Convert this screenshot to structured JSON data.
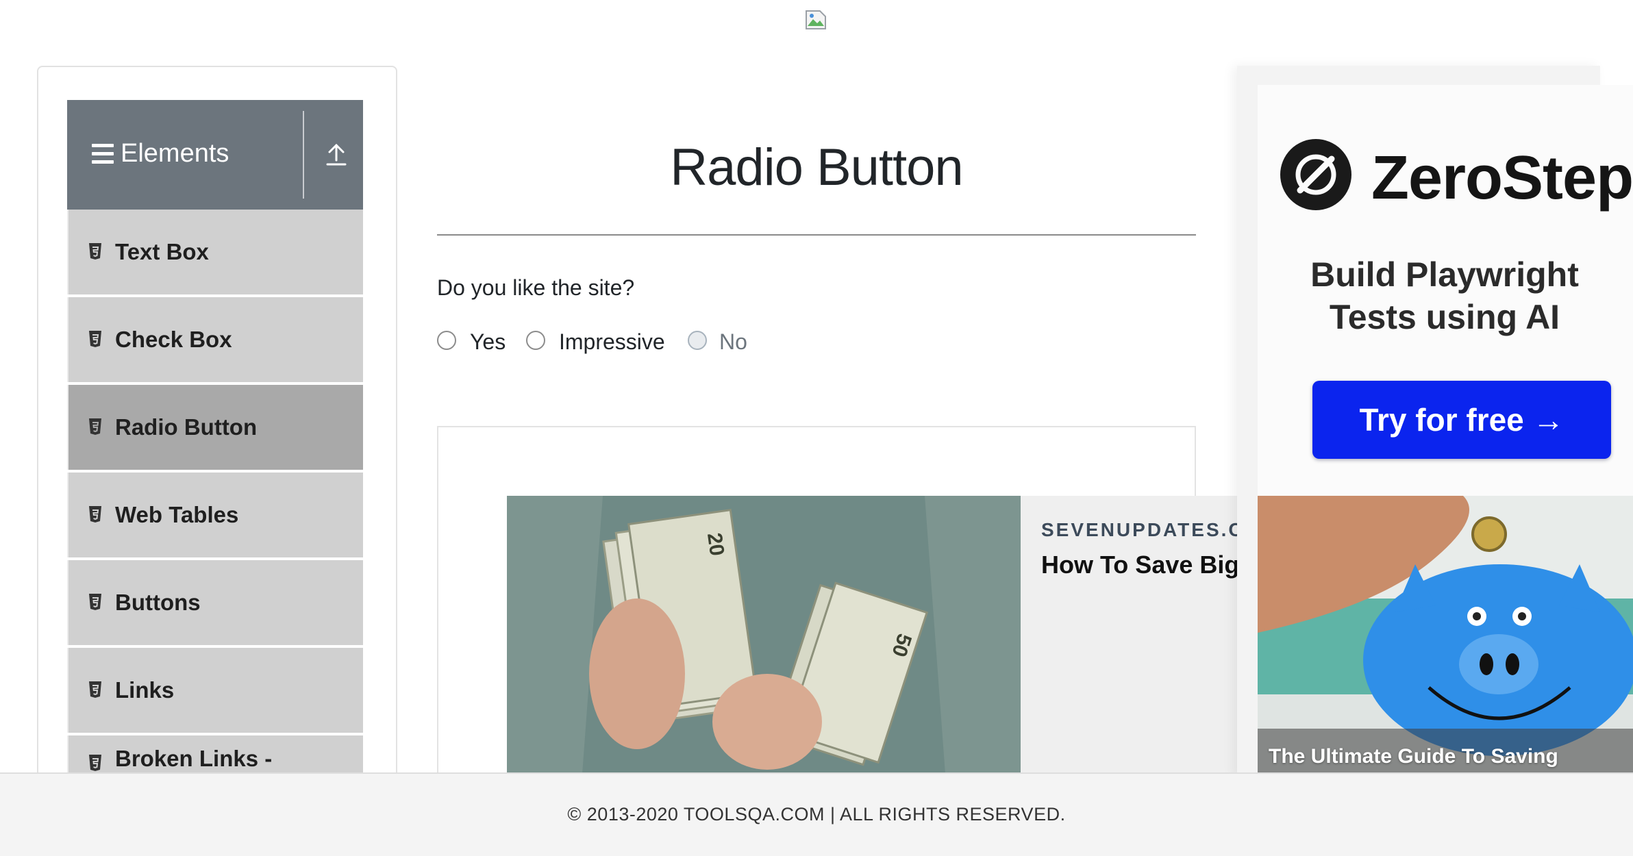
{
  "page": {
    "title": "Radio Button"
  },
  "sidebar": {
    "group": {
      "title": "Elements"
    },
    "items": [
      {
        "label": "Text Box"
      },
      {
        "label": "Check Box"
      },
      {
        "label": "Radio Button",
        "active": true
      },
      {
        "label": "Web Tables"
      },
      {
        "label": "Buttons"
      },
      {
        "label": "Links"
      },
      {
        "label": "Broken Links -"
      }
    ]
  },
  "form": {
    "question": "Do you like the site?",
    "options": [
      {
        "label": "Yes",
        "disabled": false
      },
      {
        "label": "Impressive",
        "disabled": false
      },
      {
        "label": "No",
        "disabled": true
      }
    ]
  },
  "native_ad": {
    "source": "SEVENUPDATES.CO",
    "headline": "How To Save Big A"
  },
  "right_ad": {
    "brand": "ZeroStep",
    "tagline_line1": "Build Playwright",
    "tagline_line2": "Tests using AI",
    "cta": "Try for free →",
    "brand_color": "#0b24ee"
  },
  "bank_ad": {
    "caption": "The Ultimate Guide To Saving"
  },
  "footer": {
    "text": "© 2013-2020 TOOLSQA.COM | ALL RIGHTS RESERVED."
  },
  "icons": {
    "broken_image": "broken-image-icon",
    "menu": "hamburger-icon",
    "collapse": "upload-arrow-icon",
    "item": "html5-icon"
  }
}
